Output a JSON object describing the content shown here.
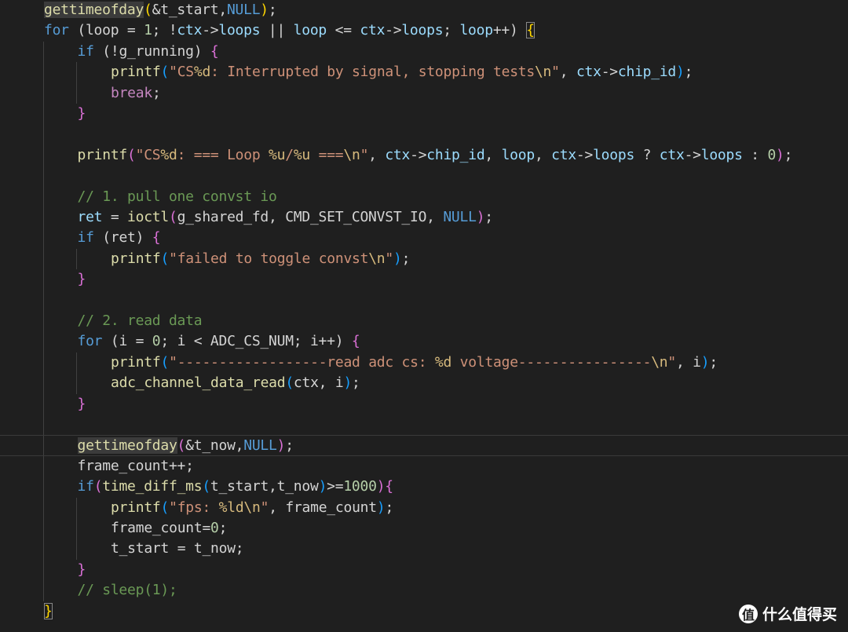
{
  "colors": {
    "background": "#1f1f1f",
    "default": "#d4d4d4",
    "keyword": "#569cd6",
    "control": "#c586c0",
    "function": "#dcdcaa",
    "variable": "#9cdcfe",
    "string": "#ce9178",
    "escape": "#d7ba7d",
    "number": "#b5cea8",
    "comment": "#6a9955",
    "constant": "#4fc1ff",
    "macro": "#569cd6",
    "bracket1": "#ffd700",
    "bracket2": "#da70d6",
    "bracket3": "#179fff"
  },
  "lines": [
    [
      [
        "gettimeofday",
        "function-hl"
      ],
      [
        "(",
        "bracket1"
      ],
      [
        "&t_start,",
        "default"
      ],
      [
        "NULL",
        "keyword"
      ],
      [
        ")",
        "bracket1"
      ],
      [
        ";",
        "default"
      ]
    ],
    [
      [
        "for",
        "keyword"
      ],
      [
        " (loop = ",
        "default"
      ],
      [
        "1",
        "number"
      ],
      [
        "; !",
        "default"
      ],
      [
        "ctx",
        "variable"
      ],
      [
        "->",
        "default"
      ],
      [
        "loops",
        "variable"
      ],
      [
        " || ",
        "default"
      ],
      [
        "loop",
        "variable"
      ],
      [
        " <= ",
        "default"
      ],
      [
        "ctx",
        "variable"
      ],
      [
        "->",
        "default"
      ],
      [
        "loops",
        "variable"
      ],
      [
        "; ",
        "default"
      ],
      [
        "loop",
        "variable"
      ],
      [
        "++) ",
        "default"
      ],
      [
        "{",
        "bracket-box"
      ]
    ],
    [
      [
        "if",
        "keyword"
      ],
      [
        " (!g_running) ",
        "default"
      ],
      [
        "{",
        "bracket2"
      ]
    ],
    [
      [
        "printf",
        "function"
      ],
      [
        "(",
        "bracket3"
      ],
      [
        "\"CS",
        "string"
      ],
      [
        "%d",
        "escape"
      ],
      [
        ": Interrupted by signal, stopping tests",
        "string"
      ],
      [
        "\\n",
        "escape"
      ],
      [
        "\"",
        "string"
      ],
      [
        ", ",
        "default"
      ],
      [
        "ctx",
        "variable"
      ],
      [
        "->",
        "default"
      ],
      [
        "chip_id",
        "variable"
      ],
      [
        ")",
        "bracket3"
      ],
      [
        ";",
        "default"
      ]
    ],
    [
      [
        "break",
        "control"
      ],
      [
        ";",
        "default"
      ]
    ],
    [
      [
        "}",
        "bracket2"
      ]
    ],
    [],
    [
      [
        "printf",
        "function"
      ],
      [
        "(",
        "bracket2"
      ],
      [
        "\"CS",
        "string"
      ],
      [
        "%d",
        "escape"
      ],
      [
        ": === Loop ",
        "string"
      ],
      [
        "%u",
        "escape"
      ],
      [
        "/",
        "string"
      ],
      [
        "%u",
        "escape"
      ],
      [
        " ===",
        "string"
      ],
      [
        "\\n",
        "escape"
      ],
      [
        "\"",
        "string"
      ],
      [
        ", ",
        "default"
      ],
      [
        "ctx",
        "variable"
      ],
      [
        "->",
        "default"
      ],
      [
        "chip_id",
        "variable"
      ],
      [
        ", ",
        "default"
      ],
      [
        "loop",
        "variable"
      ],
      [
        ", ",
        "default"
      ],
      [
        "ctx",
        "variable"
      ],
      [
        "->",
        "default"
      ],
      [
        "loops",
        "variable"
      ],
      [
        " ? ",
        "default"
      ],
      [
        "ctx",
        "variable"
      ],
      [
        "->",
        "default"
      ],
      [
        "loops",
        "variable"
      ],
      [
        " : ",
        "default"
      ],
      [
        "0",
        "number"
      ],
      [
        ")",
        "bracket2"
      ],
      [
        ";",
        "default"
      ]
    ],
    [],
    [
      [
        "// 1. pull one convst io",
        "comment"
      ]
    ],
    [
      [
        "ret",
        "variable"
      ],
      [
        " = ",
        "default"
      ],
      [
        "ioctl",
        "function"
      ],
      [
        "(",
        "bracket2"
      ],
      [
        "g_shared_fd, CMD_SET_CONVST_IO, ",
        "default"
      ],
      [
        "NULL",
        "keyword"
      ],
      [
        ")",
        "bracket2"
      ],
      [
        ";",
        "default"
      ]
    ],
    [
      [
        "if",
        "keyword"
      ],
      [
        " (ret) ",
        "default"
      ],
      [
        "{",
        "bracket2"
      ]
    ],
    [
      [
        "printf",
        "function"
      ],
      [
        "(",
        "bracket3"
      ],
      [
        "\"failed to toggle convst",
        "string"
      ],
      [
        "\\n",
        "escape"
      ],
      [
        "\"",
        "string"
      ],
      [
        ")",
        "bracket3"
      ],
      [
        ";",
        "default"
      ]
    ],
    [
      [
        "}",
        "bracket2"
      ]
    ],
    [],
    [
      [
        "// 2. read data",
        "comment"
      ]
    ],
    [
      [
        "for",
        "keyword"
      ],
      [
        " (i = ",
        "default"
      ],
      [
        "0",
        "number"
      ],
      [
        "; i < ADC_CS_NUM; i++) ",
        "default"
      ],
      [
        "{",
        "bracket2"
      ]
    ],
    [
      [
        "printf",
        "function"
      ],
      [
        "(",
        "bracket3"
      ],
      [
        "\"------------------read adc cs: ",
        "string"
      ],
      [
        "%d",
        "escape"
      ],
      [
        " voltage----------------",
        "string"
      ],
      [
        "\\n",
        "escape"
      ],
      [
        "\"",
        "string"
      ],
      [
        ", i",
        "default"
      ],
      [
        ")",
        "bracket3"
      ],
      [
        ";",
        "default"
      ]
    ],
    [
      [
        "adc_channel_data_read",
        "function"
      ],
      [
        "(",
        "bracket3"
      ],
      [
        "ctx, i",
        "default"
      ],
      [
        ")",
        "bracket3"
      ],
      [
        ";",
        "default"
      ]
    ],
    [
      [
        "}",
        "bracket2"
      ]
    ],
    [],
    [
      [
        "gettimeofday",
        "function-hl"
      ],
      [
        "(",
        "bracket2"
      ],
      [
        "&t_now,",
        "default"
      ],
      [
        "NULL",
        "keyword"
      ],
      [
        ")",
        "bracket2"
      ],
      [
        ";",
        "default"
      ]
    ],
    [
      [
        "frame_count++;",
        "default"
      ]
    ],
    [
      [
        "if",
        "keyword"
      ],
      [
        "(",
        "bracket2"
      ],
      [
        "time_diff_ms",
        "function"
      ],
      [
        "(",
        "bracket3"
      ],
      [
        "t_start,t_now",
        "default"
      ],
      [
        ")",
        "bracket3"
      ],
      [
        ">=",
        "default"
      ],
      [
        "1000",
        "number"
      ],
      [
        ")",
        "bracket2"
      ],
      [
        "{",
        "bracket2"
      ]
    ],
    [
      [
        "printf",
        "function"
      ],
      [
        "(",
        "bracket3"
      ],
      [
        "\"fps: ",
        "string"
      ],
      [
        "%ld",
        "escape"
      ],
      [
        "\\n",
        "escape"
      ],
      [
        "\"",
        "string"
      ],
      [
        ", frame_count",
        "default"
      ],
      [
        ")",
        "bracket3"
      ],
      [
        ";",
        "default"
      ]
    ],
    [
      [
        "frame_count=",
        "default"
      ],
      [
        "0",
        "number"
      ],
      [
        ";",
        "default"
      ]
    ],
    [
      [
        "t_start = t_now;",
        "default"
      ]
    ],
    [
      [
        "}",
        "bracket2"
      ]
    ],
    [
      [
        "// sleep(1);",
        "comment"
      ]
    ],
    [
      [
        "}",
        "bracket-box"
      ]
    ]
  ],
  "indents": [
    1,
    1,
    2,
    3,
    3,
    2,
    2,
    2,
    2,
    2,
    2,
    2,
    3,
    2,
    2,
    2,
    2,
    3,
    3,
    2,
    2,
    2,
    2,
    2,
    3,
    3,
    3,
    2,
    2,
    1
  ],
  "watermark": {
    "logo": "值",
    "text": "什么值得买"
  }
}
